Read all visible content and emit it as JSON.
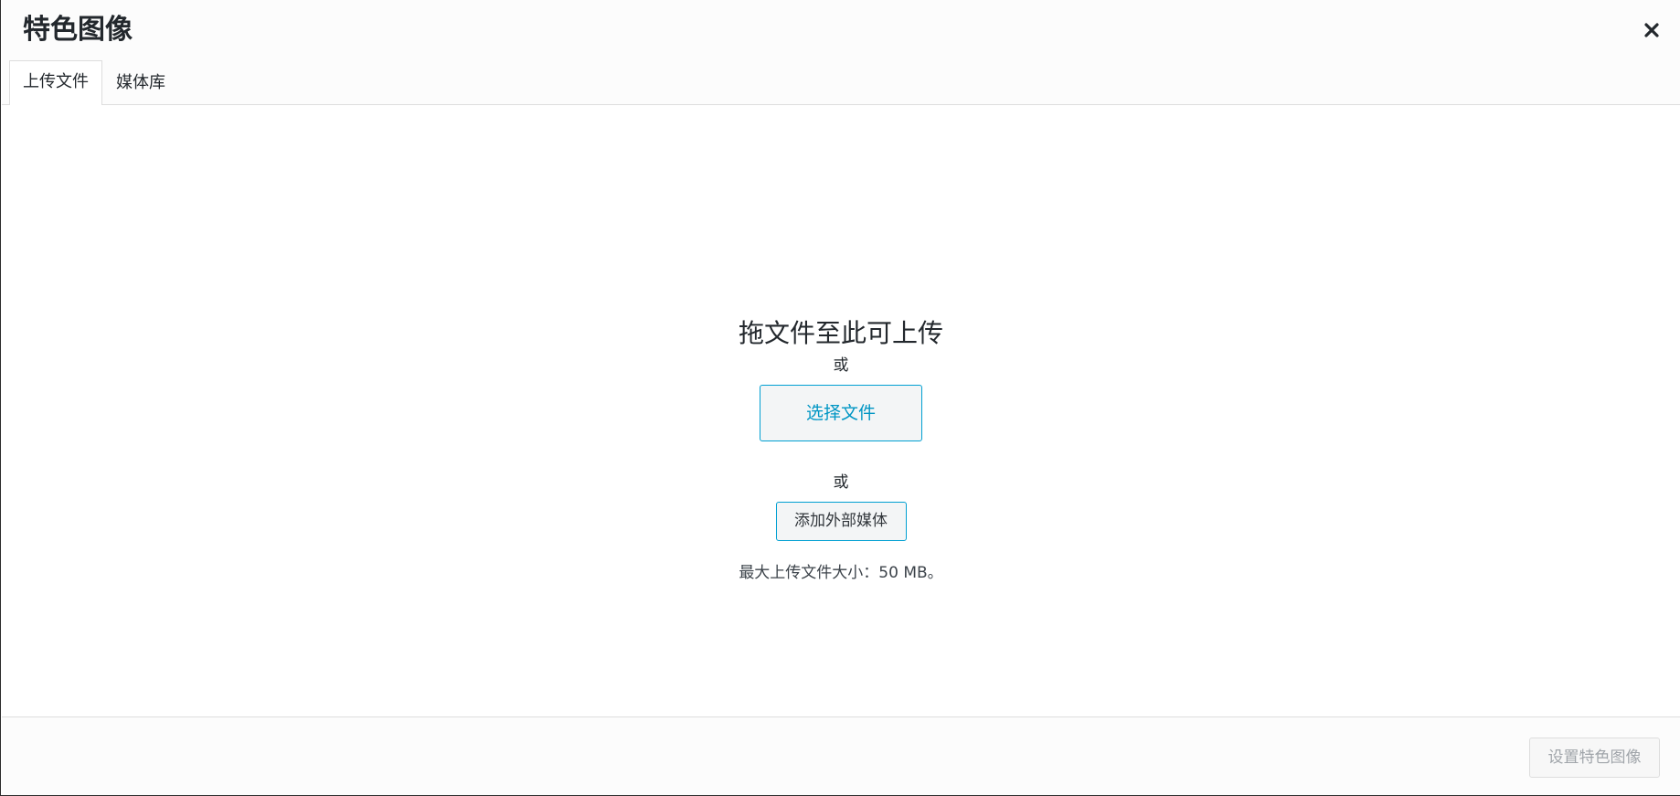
{
  "modal": {
    "title": "特色图像",
    "close_icon": "close-icon"
  },
  "tabs": [
    {
      "label": "上传文件",
      "active": true
    },
    {
      "label": "媒体库",
      "active": false
    }
  ],
  "upload": {
    "drop_instructions": "拖文件至此可上传",
    "or_1": "或",
    "select_files_label": "选择文件",
    "or_2": "或",
    "add_external_label": "添加外部媒体",
    "max_size_text": "最大上传文件大小：50 MB。"
  },
  "footer": {
    "set_featured_label": "设置特色图像",
    "set_featured_disabled": true
  },
  "colors": {
    "accent": "#00a0d2",
    "link": "#0096c4",
    "disabled_text": "#a0a5aa"
  }
}
